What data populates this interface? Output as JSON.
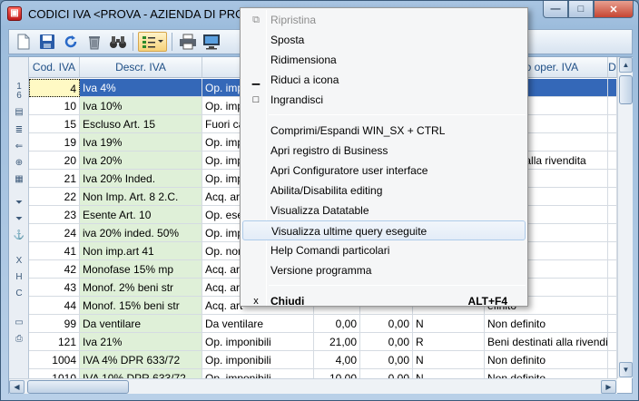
{
  "window": {
    "title": "CODICI IVA <PROVA - AZIENDA DI PROVA"
  },
  "caption": {
    "minimize": "—",
    "maximize": "□",
    "close": "✕"
  },
  "toolbar": {
    "icons": [
      "new-document-icon",
      "save-icon",
      "refresh-icon",
      "delete-icon",
      "binoculars-icon",
      "list-layout-icon",
      "print-icon",
      "monitor-icon"
    ]
  },
  "leftbar": [
    "1",
    "6"
  ],
  "grid": {
    "headers": {
      "code": "Cod. IVA",
      "desc": "Descr. IVA",
      "tipo": "T",
      "op": "tipo oper. IVA",
      "x": "D"
    },
    "rows": [
      {
        "code": "4",
        "desc": "Iva 4%",
        "tipo": "Op. impo",
        "a": "",
        "b": "",
        "n": "",
        "op": "efinito",
        "sel": true
      },
      {
        "code": "10",
        "desc": "Iva 10%",
        "tipo": "Op. impo",
        "a": "",
        "b": "",
        "n": "",
        "op": "efinito"
      },
      {
        "code": "15",
        "desc": "Escluso Art. 15",
        "tipo": "Fuori ca",
        "a": "",
        "b": "",
        "n": "",
        "op": "efinito"
      },
      {
        "code": "19",
        "desc": "Iva 19%",
        "tipo": "Op. impo",
        "a": "",
        "b": "",
        "n": "",
        "op": "efinito"
      },
      {
        "code": "20",
        "desc": "Iva 20%",
        "tipo": "Op. impo",
        "a": "",
        "b": "",
        "n": "",
        "op": "estinati alla rivendita"
      },
      {
        "code": "21",
        "desc": "Iva 20% Inded.",
        "tipo": "Op. impo",
        "a": "",
        "b": "",
        "n": "",
        "op": "efinito"
      },
      {
        "code": "22",
        "desc": "Non Imp. Art. 8 2.C.",
        "tipo": "Acq. art",
        "a": "",
        "b": "",
        "n": "",
        "op": "efinito"
      },
      {
        "code": "23",
        "desc": "Esente Art. 10",
        "tipo": "Op. esen",
        "a": "",
        "b": "",
        "n": "",
        "op": "efinito"
      },
      {
        "code": "24",
        "desc": "iva 20% inded. 50%",
        "tipo": "Op. impo",
        "a": "",
        "b": "",
        "n": "",
        "op": "efinito"
      },
      {
        "code": "41",
        "desc": "Non imp.art 41",
        "tipo": "Op. non",
        "a": "",
        "b": "",
        "n": "",
        "op": "efinito"
      },
      {
        "code": "42",
        "desc": "Monofase 15% mp",
        "tipo": "Acq. art",
        "a": "",
        "b": "",
        "n": "",
        "op": "efinito"
      },
      {
        "code": "43",
        "desc": "Monof. 2% beni str",
        "tipo": "Acq. art",
        "a": "",
        "b": "",
        "n": "",
        "op": "efinito"
      },
      {
        "code": "44",
        "desc": "Monof. 15% beni str",
        "tipo": "Acq. art",
        "a": "",
        "b": "",
        "n": "",
        "op": "efinito"
      },
      {
        "code": "99",
        "desc": "Da ventilare",
        "tipo": "Da ventilare",
        "a": "0,00",
        "b": "0,00",
        "n": "N",
        "op": "Non definito"
      },
      {
        "code": "121",
        "desc": "Iva 21%",
        "tipo": "Op. imponibili",
        "a": "21,00",
        "b": "0,00",
        "n": "R",
        "op": "Beni destinati alla rivendita"
      },
      {
        "code": "1004",
        "desc": "IVA 4% DPR 633/72",
        "tipo": "Op. imponibili",
        "a": "4,00",
        "b": "0,00",
        "n": "N",
        "op": "Non definito"
      },
      {
        "code": "1010",
        "desc": "IVA 10% DPR 633/72",
        "tipo": "Op. imponibili",
        "a": "10,00",
        "b": "0,00",
        "n": "N",
        "op": "Non definito"
      }
    ]
  },
  "context_menu": {
    "items": [
      {
        "label": "Ripristina",
        "icon": "⧉",
        "disabled": true
      },
      {
        "label": "Sposta"
      },
      {
        "label": "Ridimensiona"
      },
      {
        "label": "Riduci a icona",
        "icon": "▁"
      },
      {
        "label": "Ingrandisci",
        "icon": "□"
      },
      {
        "sep": true
      },
      {
        "label": "Comprimi/Espandi WIN_SX + CTRL"
      },
      {
        "label": "Apri registro di Business"
      },
      {
        "label": "Apri Configuratore user interface"
      },
      {
        "label": "Abilita/Disabilita editing"
      },
      {
        "label": "Visualizza Datatable"
      },
      {
        "label": "Visualizza ultime query eseguite",
        "hover": true
      },
      {
        "label": "Help Comandi particolari"
      },
      {
        "label": "Versione programma"
      },
      {
        "sep": true
      },
      {
        "label": "Chiudi",
        "icon": "x",
        "bold": true,
        "shortcut": "ALT+F4"
      }
    ]
  }
}
